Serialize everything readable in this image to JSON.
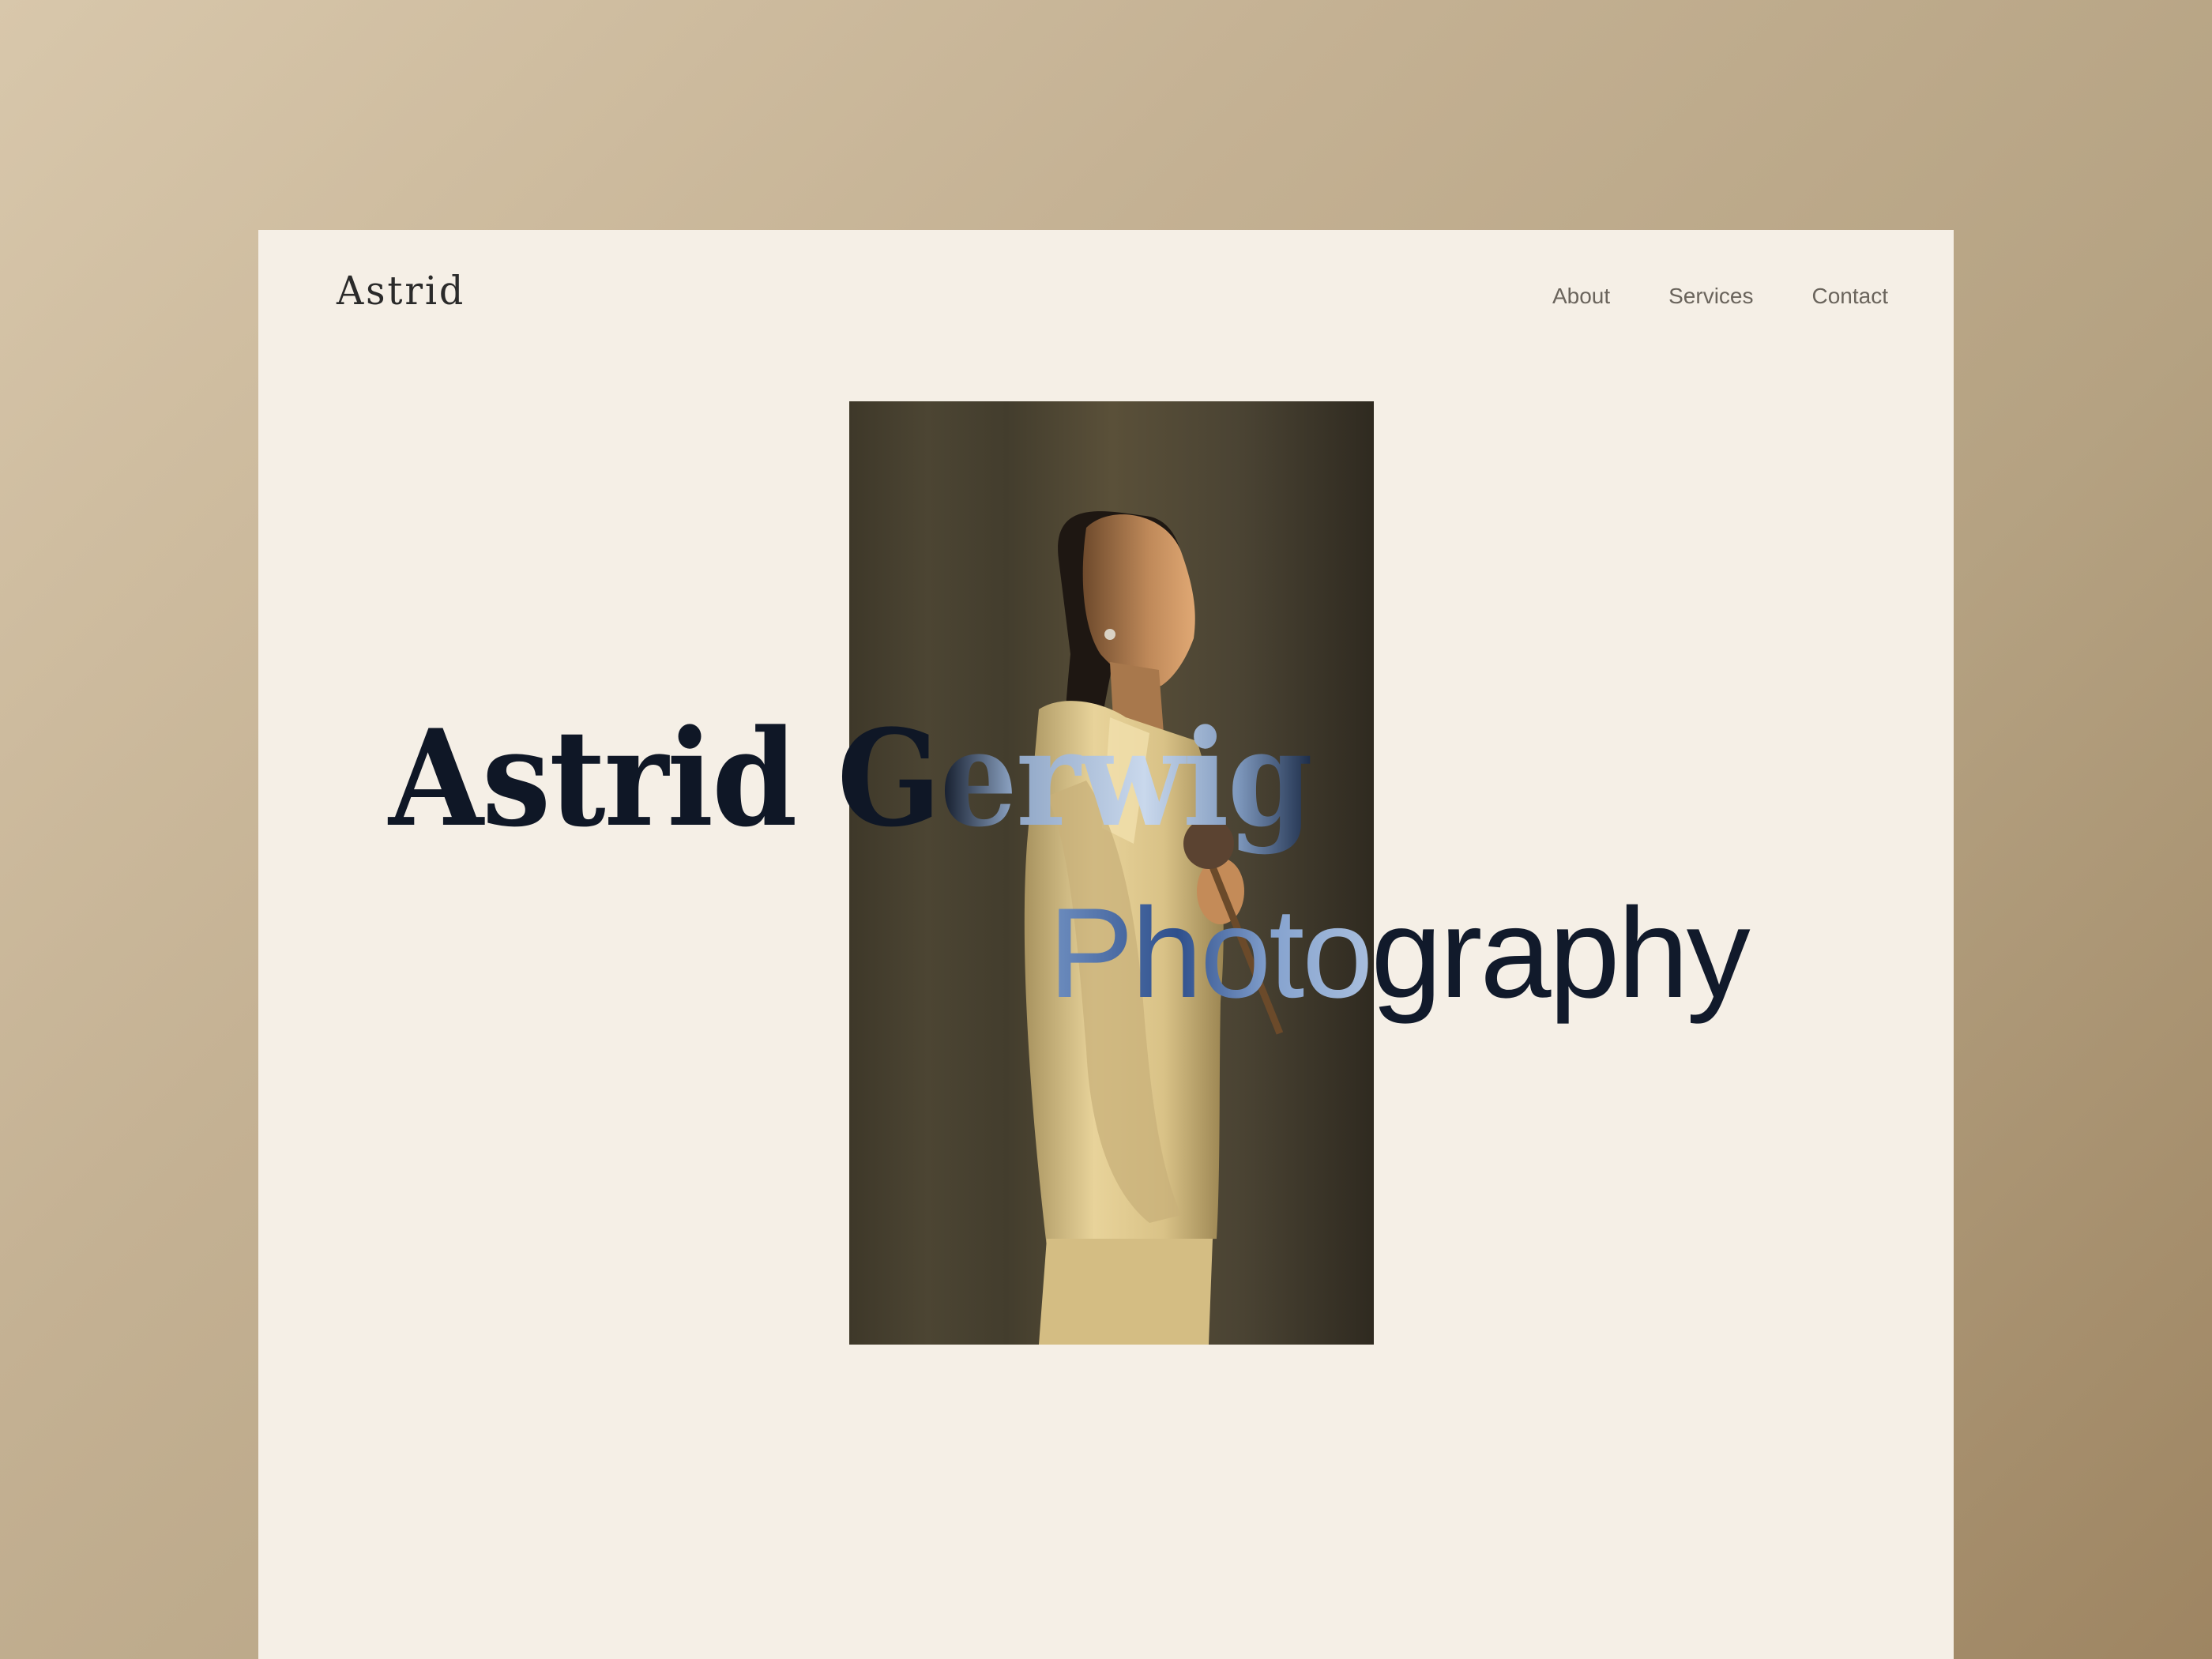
{
  "brand": {
    "logo": "Astrid"
  },
  "nav": {
    "items": [
      {
        "label": "About"
      },
      {
        "label": "Services"
      },
      {
        "label": "Contact"
      }
    ]
  },
  "hero": {
    "title_plain": "Astrid G",
    "title_overlay": "erwig",
    "subtitle_overlay": "Photo",
    "subtitle_plain": "graphy"
  },
  "colors": {
    "page_background": "#f5efe6",
    "backdrop": "#c4b193",
    "title": "#0f1726",
    "nav_text": "#6a645c"
  }
}
